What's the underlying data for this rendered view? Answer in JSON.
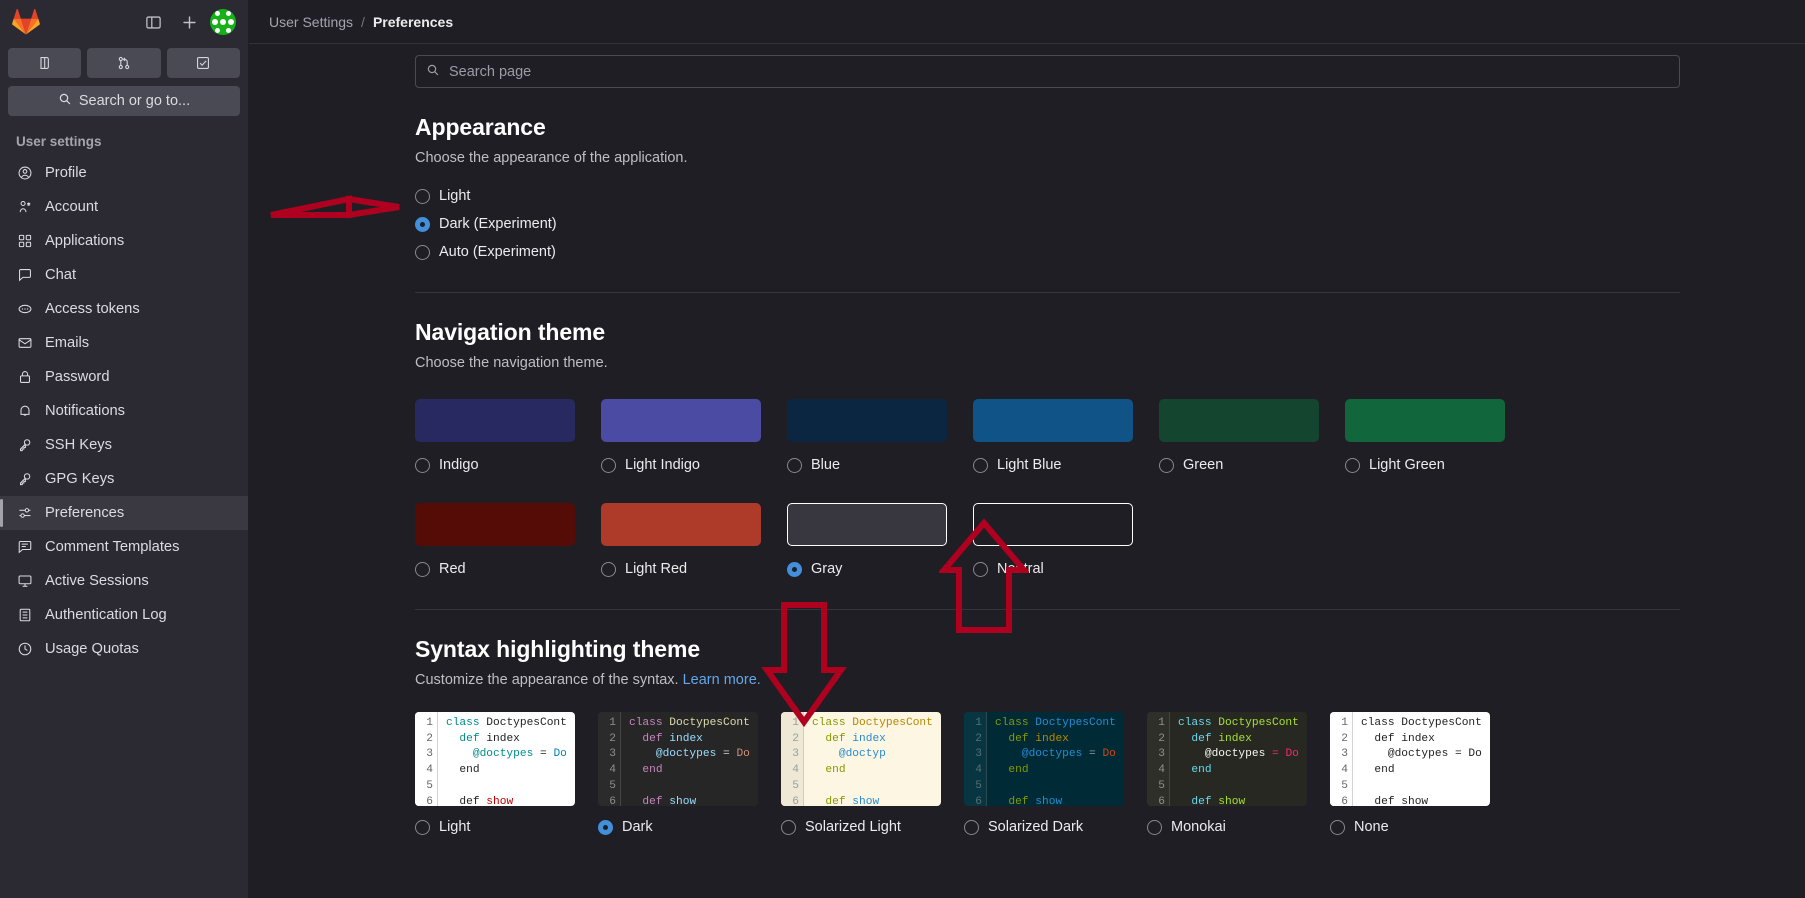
{
  "app": {
    "logo_icon": "gitlab-logo-icon",
    "toggle_sidebar_icon": "panel-toggle-icon",
    "new_icon": "plus-icon",
    "avatar_icon": "user-avatar"
  },
  "sidebar": {
    "quick_actions": [
      {
        "name": "issues-shortcut",
        "icon": "issue-icon"
      },
      {
        "name": "merge-requests-shortcut",
        "icon": "merge-request-icon"
      },
      {
        "name": "todos-shortcut",
        "icon": "todo-check-icon"
      }
    ],
    "search": {
      "label": "Search or go to...",
      "icon": "search-icon"
    },
    "heading": "User settings",
    "items": [
      {
        "label": "Profile",
        "icon": "user-circle-icon",
        "active": false
      },
      {
        "label": "Account",
        "icon": "account-icon",
        "active": false
      },
      {
        "label": "Applications",
        "icon": "applications-grid-icon",
        "active": false
      },
      {
        "label": "Chat",
        "icon": "chat-bubble-icon",
        "active": false
      },
      {
        "label": "Access tokens",
        "icon": "token-icon",
        "active": false
      },
      {
        "label": "Emails",
        "icon": "envelope-icon",
        "active": false
      },
      {
        "label": "Password",
        "icon": "lock-icon",
        "active": false
      },
      {
        "label": "Notifications",
        "icon": "bell-icon",
        "active": false
      },
      {
        "label": "SSH Keys",
        "icon": "key-icon",
        "active": false
      },
      {
        "label": "GPG Keys",
        "icon": "key-icon",
        "active": false
      },
      {
        "label": "Preferences",
        "icon": "preferences-sliders-icon",
        "active": true
      },
      {
        "label": "Comment Templates",
        "icon": "comment-template-icon",
        "active": false
      },
      {
        "label": "Active Sessions",
        "icon": "monitor-icon",
        "active": false
      },
      {
        "label": "Authentication Log",
        "icon": "log-list-icon",
        "active": false
      },
      {
        "label": "Usage Quotas",
        "icon": "quota-clock-icon",
        "active": false
      }
    ]
  },
  "breadcrumb": {
    "parent": "User Settings",
    "separator": "/",
    "current": "Preferences"
  },
  "search_page": {
    "placeholder": "Search page",
    "value": "",
    "icon": "search-icon"
  },
  "appearance": {
    "title": "Appearance",
    "description": "Choose the appearance of the application.",
    "options": [
      {
        "label": "Light",
        "selected": false
      },
      {
        "label": "Dark (Experiment)",
        "selected": true
      },
      {
        "label": "Auto (Experiment)",
        "selected": false
      }
    ]
  },
  "navigation_theme": {
    "title": "Navigation theme",
    "description": "Choose the navigation theme.",
    "options": [
      {
        "label": "Indigo",
        "color": "#292961",
        "outlined": false,
        "selected": false
      },
      {
        "label": "Light Indigo",
        "color": "#4b4ba3",
        "outlined": false,
        "selected": false
      },
      {
        "label": "Blue",
        "color": "#0b2640",
        "outlined": false,
        "selected": false
      },
      {
        "label": "Light Blue",
        "color": "#0f5387",
        "outlined": false,
        "selected": false
      },
      {
        "label": "Green",
        "color": "#14462f",
        "outlined": false,
        "selected": false
      },
      {
        "label": "Light Green",
        "color": "#12663c",
        "outlined": false,
        "selected": false
      },
      {
        "label": "Red",
        "color": "#550c07",
        "outlined": false,
        "selected": false
      },
      {
        "label": "Light Red",
        "color": "#ae3b2a",
        "outlined": false,
        "selected": false
      },
      {
        "label": "Gray",
        "color": "#38373f",
        "outlined": true,
        "selected": true
      },
      {
        "label": "Neutral",
        "color": "#1f1e24",
        "outlined": true,
        "selected": false
      }
    ]
  },
  "syntax_theme": {
    "title": "Syntax highlighting theme",
    "description": "Customize the appearance of the syntax.",
    "learn_more": "Learn more.",
    "line_numbers": [
      "1",
      "2",
      "3",
      "4",
      "5",
      "6"
    ],
    "code_lines": [
      "class DoctypesCont",
      "  def index",
      "    @doctypes = Do",
      "  end",
      "",
      "  def show"
    ],
    "options": [
      {
        "label": "Light",
        "selected": false,
        "bg": "#ffffff",
        "gutter_bg": "#ffffff",
        "gutter_fg": "#666666",
        "tokens": [
          [
            [
              "class ",
              "#008b8b"
            ],
            [
              "DoctypesCont",
              "#1f1f1f"
            ]
          ],
          [
            [
              "  def ",
              "#008b8b"
            ],
            [
              "index",
              "#1f1f1f"
            ]
          ],
          [
            [
              "    @doctypes ",
              "#008b8b"
            ],
            [
              "= ",
              "#1f1f1f"
            ],
            [
              "Do",
              "#0086b3"
            ]
          ],
          [
            [
              "  end",
              "#1f1f1f"
            ]
          ],
          [
            [
              "",
              "#1f1f1f"
            ]
          ],
          [
            [
              "  def ",
              "#1f1f1f"
            ],
            [
              "show",
              "#bb0000"
            ]
          ]
        ]
      },
      {
        "label": "Dark",
        "selected": true,
        "bg": "#262626",
        "gutter_bg": "#2b2b2b",
        "gutter_fg": "#8f8f8f",
        "tokens": [
          [
            [
              "class ",
              "#c586c0"
            ],
            [
              "DoctypesCont",
              "#dcdcaa"
            ]
          ],
          [
            [
              "  def ",
              "#c586c0"
            ],
            [
              "index",
              "#9cdcfe"
            ]
          ],
          [
            [
              "    @doctypes ",
              "#9cdcfe"
            ],
            [
              "= ",
              "#d4d4d4"
            ],
            [
              "Do",
              "#ce9178"
            ]
          ],
          [
            [
              "  end",
              "#c586c0"
            ]
          ],
          [
            [
              "",
              "#d4d4d4"
            ]
          ],
          [
            [
              "  def ",
              "#c586c0"
            ],
            [
              "show",
              "#9cdcfe"
            ]
          ]
        ]
      },
      {
        "label": "Solarized Light",
        "selected": false,
        "bg": "#fdf6e3",
        "gutter_bg": "#eee8d5",
        "gutter_fg": "#93a1a1",
        "tokens": [
          [
            [
              "class ",
              "#859900"
            ],
            [
              "DoctypesCont",
              "#b58900"
            ]
          ],
          [
            [
              "  def ",
              "#859900"
            ],
            [
              "index",
              "#268bd2"
            ]
          ],
          [
            [
              "    @doctyp",
              "#268bd2"
            ]
          ],
          [
            [
              "  end",
              "#859900"
            ]
          ],
          [
            [
              "",
              "#657b83"
            ]
          ],
          [
            [
              "  def ",
              "#859900"
            ],
            [
              "show",
              "#268bd2"
            ]
          ]
        ]
      },
      {
        "label": "Solarized Dark",
        "selected": false,
        "bg": "#002b36",
        "gutter_bg": "#073642",
        "gutter_fg": "#586e75",
        "tokens": [
          [
            [
              "class ",
              "#859900"
            ],
            [
              "DoctypesCont",
              "#268bd2"
            ]
          ],
          [
            [
              "  def ",
              "#859900"
            ],
            [
              "index",
              "#b58900"
            ]
          ],
          [
            [
              "    @doctypes ",
              "#268bd2"
            ],
            [
              "= ",
              "#93a1a1"
            ],
            [
              "Do",
              "#cb4b16"
            ]
          ],
          [
            [
              "  end",
              "#859900"
            ]
          ],
          [
            [
              "",
              "#93a1a1"
            ]
          ],
          [
            [
              "  def ",
              "#859900"
            ],
            [
              "show",
              "#268bd2"
            ]
          ]
        ]
      },
      {
        "label": "Monokai",
        "selected": false,
        "bg": "#272822",
        "gutter_bg": "#2e2f28",
        "gutter_fg": "#90918b",
        "tokens": [
          [
            [
              "class ",
              "#66d9ef"
            ],
            [
              "DoctypesCont",
              "#a6e22e"
            ]
          ],
          [
            [
              "  def ",
              "#66d9ef"
            ],
            [
              "index",
              "#a6e22e"
            ]
          ],
          [
            [
              "    @doctypes ",
              "#f8f8f2"
            ],
            [
              "= ",
              "#f92672"
            ],
            [
              "Do",
              "#f92672"
            ]
          ],
          [
            [
              "  end",
              "#66d9ef"
            ]
          ],
          [
            [
              "",
              "#f8f8f2"
            ]
          ],
          [
            [
              "  def ",
              "#66d9ef"
            ],
            [
              "show",
              "#a6e22e"
            ]
          ]
        ]
      },
      {
        "label": "None",
        "selected": false,
        "bg": "#ffffff",
        "gutter_bg": "#ffffff",
        "gutter_fg": "#666666",
        "tokens": [
          [
            [
              "class DoctypesCont",
              "#1f1f1f"
            ]
          ],
          [
            [
              "  def index",
              "#1f1f1f"
            ]
          ],
          [
            [
              "    @doctypes = Do",
              "#1f1f1f"
            ]
          ],
          [
            [
              "  end",
              "#1f1f1f"
            ]
          ],
          [
            [
              "",
              "#1f1f1f"
            ]
          ],
          [
            [
              "  def show",
              "#1f1f1f"
            ]
          ]
        ]
      }
    ]
  },
  "annotations": {
    "color": "#b00020",
    "arrows": [
      {
        "name": "arrow-pointing-dark-experiment",
        "direction": "right"
      },
      {
        "name": "arrow-pointing-gray-theme",
        "direction": "up"
      },
      {
        "name": "arrow-pointing-dark-syntax",
        "direction": "down"
      }
    ]
  }
}
